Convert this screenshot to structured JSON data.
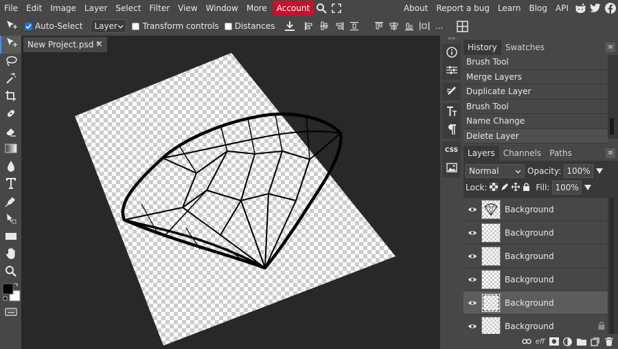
{
  "menu": {
    "items": [
      "File",
      "Edit",
      "Image",
      "Layer",
      "Select",
      "Filter",
      "View",
      "Window",
      "More"
    ],
    "account": "Account",
    "right": [
      "About",
      "Report a bug",
      "Learn",
      "Blog",
      "API"
    ]
  },
  "options": {
    "auto_select_label": "Auto-Select",
    "auto_select_checked": true,
    "target_value": "Layer",
    "transform_controls_label": "Transform controls",
    "distances_label": "Distances",
    "more": "..."
  },
  "document": {
    "tab_label": "New Project.psd *",
    "close": "×"
  },
  "history": {
    "tabs": [
      "History",
      "Swatches"
    ],
    "items": [
      "Brush Tool",
      "Merge Layers",
      "Duplicate Layer",
      "Brush Tool",
      "Name Change",
      "Delete Layer"
    ],
    "menu": "≡"
  },
  "layers_panel": {
    "tabs": [
      "Layers",
      "Channels",
      "Paths"
    ],
    "blend_mode": "Normal",
    "opacity_label": "Opacity:",
    "opacity_value": "100%",
    "lock_label": "Lock:",
    "fill_label": "Fill:",
    "fill_value": "100%",
    "layers": [
      {
        "name": "Background",
        "selected": false
      },
      {
        "name": "Background",
        "selected": false
      },
      {
        "name": "Background",
        "selected": false
      },
      {
        "name": "Background",
        "selected": false
      },
      {
        "name": "Background",
        "selected": true
      },
      {
        "name": "Background",
        "selected": false,
        "locked": true
      }
    ],
    "bottom_icons": [
      "link-icon",
      "effects-icon",
      "mask-icon",
      "adjustment-icon",
      "folder-icon",
      "new-layer-icon",
      "delete-icon"
    ],
    "effects_label": "eff"
  },
  "colors": {
    "accent": "#c8102e",
    "selection": "#1a73e8",
    "panel_bg": "#474747",
    "canvas_bg": "#282828"
  }
}
